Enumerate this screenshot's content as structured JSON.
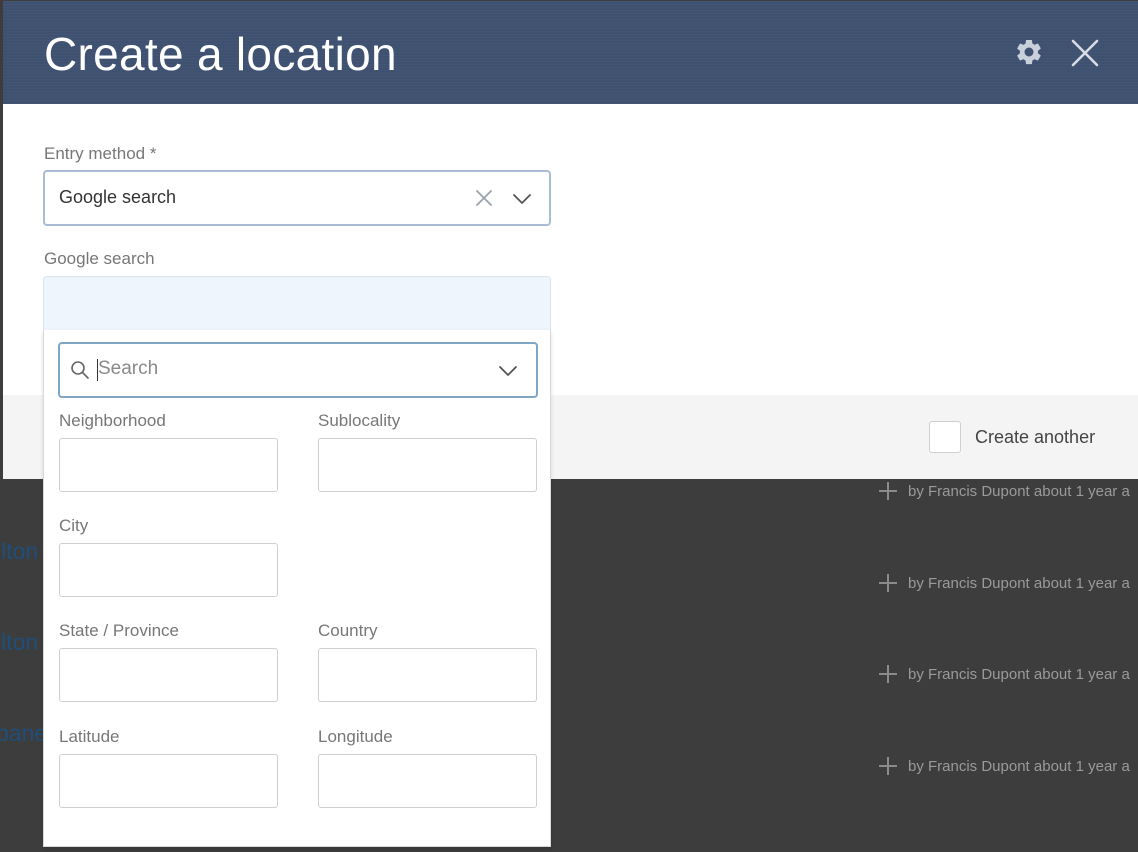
{
  "background": {
    "rows": [
      {
        "text": "by Francis Dupont about 1 year a"
      },
      {
        "text": "by Francis Dupont about 1 year a"
      },
      {
        "text": "by Francis Dupont about 1 year a"
      },
      {
        "text": "by Francis Dupont about 1 year a"
      }
    ],
    "left_fragments": [
      "ilton",
      "ilton",
      "bane"
    ]
  },
  "modal": {
    "title": "Create a location",
    "settings_icon": "gear-icon",
    "close_icon": "close-icon",
    "entry_method": {
      "label": "Entry method *",
      "value": "Google search",
      "clear_icon": "clear-icon",
      "dropdown_icon": "chevron-down-icon"
    },
    "google_search": {
      "label": "Google search",
      "search_placeholder": "Search",
      "fields": {
        "neighborhood": "Neighborhood",
        "sublocality": "Sublocality",
        "city": "City",
        "state": "State / Province",
        "country": "Country",
        "latitude": "Latitude",
        "longitude": "Longitude"
      }
    },
    "footer": {
      "create_another": "Create another"
    }
  },
  "colors": {
    "header": "#3f5171",
    "focus_border": "#7fa7c4",
    "search_bg": "#eef5fd"
  }
}
